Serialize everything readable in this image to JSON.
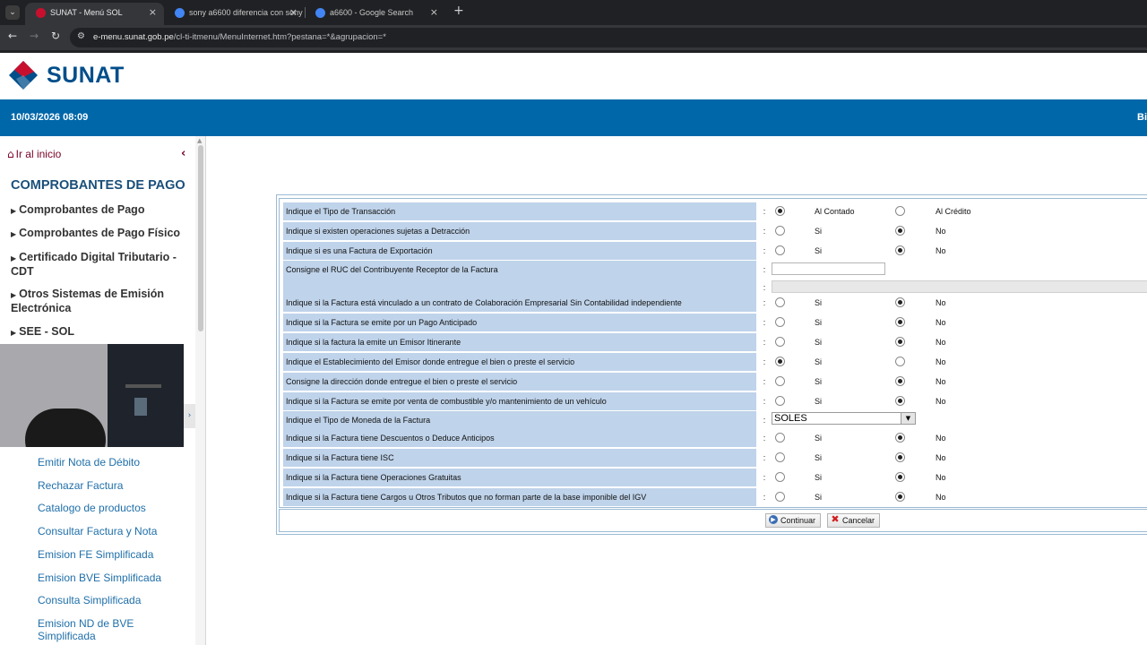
{
  "browser": {
    "tabs": [
      {
        "title": "SUNAT - Menú SOL",
        "active": true,
        "favicon_color": "#c8102e"
      },
      {
        "title": "sony a6600 diferencia con sony",
        "active": false,
        "favicon_color": "#4285f4"
      },
      {
        "title": "a6600 - Google Search",
        "active": false,
        "favicon_color": "#4285f4"
      }
    ],
    "url_host": "e-menu.sunat.gob.pe",
    "url_path": "/cl-ti-itmenu/MenuInternet.htm?pestana=*&agrupacion=*"
  },
  "header": {
    "logo_text": "SUNAT",
    "datetime": "10/03/2026 08:09",
    "right_text": "Bi",
    "brand_color": "#004e8a",
    "bar_color": "#0067a9"
  },
  "sidebar": {
    "home_label": "Ir al inicio",
    "section_title": "COMPROBANTES DE PAGO",
    "menu": [
      "Comprobantes de Pago",
      "Comprobantes de Pago Físico",
      "Certificado Digital Tributario - CDT",
      "Otros Sistemas de Emisión Electrónica",
      "SEE - SOL"
    ],
    "links": [
      "Emitir Nota de Débito",
      "Rechazar Factura",
      "Catalogo de productos",
      "Consultar Factura y Nota",
      "Emision FE Simplificada",
      "Emision BVE Simplificada",
      "Consulta Simplificada",
      "Emision ND de BVE Simplificada"
    ]
  },
  "form": {
    "colon": ":",
    "rows": [
      {
        "label": "Indique el Tipo de Transacción",
        "type": "radio",
        "opt1": "Al Contado",
        "opt2": "Al Crédito",
        "selected": 1
      },
      {
        "label": "Indique si existen operaciones sujetas a Detracción",
        "type": "radio",
        "opt1": "Si",
        "opt2": "No",
        "selected": 2
      },
      {
        "label": "Indique si es una Factura de Exportación",
        "type": "radio",
        "opt1": "Si",
        "opt2": "No",
        "selected": 2
      },
      {
        "label": "Consigne el RUC del Contribuyente Receptor de la Factura",
        "type": "text",
        "value": ""
      },
      {
        "label": "",
        "type": "blank"
      },
      {
        "label": "Indique si la Factura está vinculado a un contrato de Colaboración Empresarial Sin Contabilidad independiente",
        "type": "radio",
        "opt1": "Si",
        "opt2": "No",
        "selected": 2
      },
      {
        "label": "Indique si la Factura se emite por un Pago Anticipado",
        "type": "radio",
        "opt1": "Si",
        "opt2": "No",
        "selected": 2
      },
      {
        "label": "Indique si la factura la emite un Emisor Itinerante",
        "type": "radio",
        "opt1": "Si",
        "opt2": "No",
        "selected": 2
      },
      {
        "label": "Indique el Establecimiento del Emisor donde entregue el bien o preste el servicio",
        "type": "radio",
        "opt1": "Si",
        "opt2": "No",
        "selected": 1
      },
      {
        "label": "Consigne la dirección donde entregue el bien o preste el servicio",
        "type": "radio",
        "opt1": "Si",
        "opt2": "No",
        "selected": 2
      },
      {
        "label": "Indique si la Factura se emite por venta de combustible y/o mantenimiento de un vehículo",
        "type": "radio",
        "opt1": "Si",
        "opt2": "No",
        "selected": 2
      },
      {
        "label": "Indique el Tipo de Moneda de la Factura",
        "type": "select",
        "value": "SOLES"
      },
      {
        "label": "Indique si la Factura tiene Descuentos o Deduce Anticipos",
        "type": "radio",
        "opt1": "Si",
        "opt2": "No",
        "selected": 2
      },
      {
        "label": "Indique si la Factura tiene ISC",
        "type": "radio",
        "opt1": "Si",
        "opt2": "No",
        "selected": 2
      },
      {
        "label": "Indique si la Factura tiene Operaciones Gratuitas",
        "type": "radio",
        "opt1": "Si",
        "opt2": "No",
        "selected": 2
      },
      {
        "label": "Indique si la Factura tiene Cargos u Otros Tributos que no forman parte de la base imponible del IGV",
        "type": "radio",
        "opt1": "Si",
        "opt2": "No",
        "selected": 2
      }
    ],
    "continue_label": "Continuar",
    "cancel_label": "Cancelar"
  }
}
